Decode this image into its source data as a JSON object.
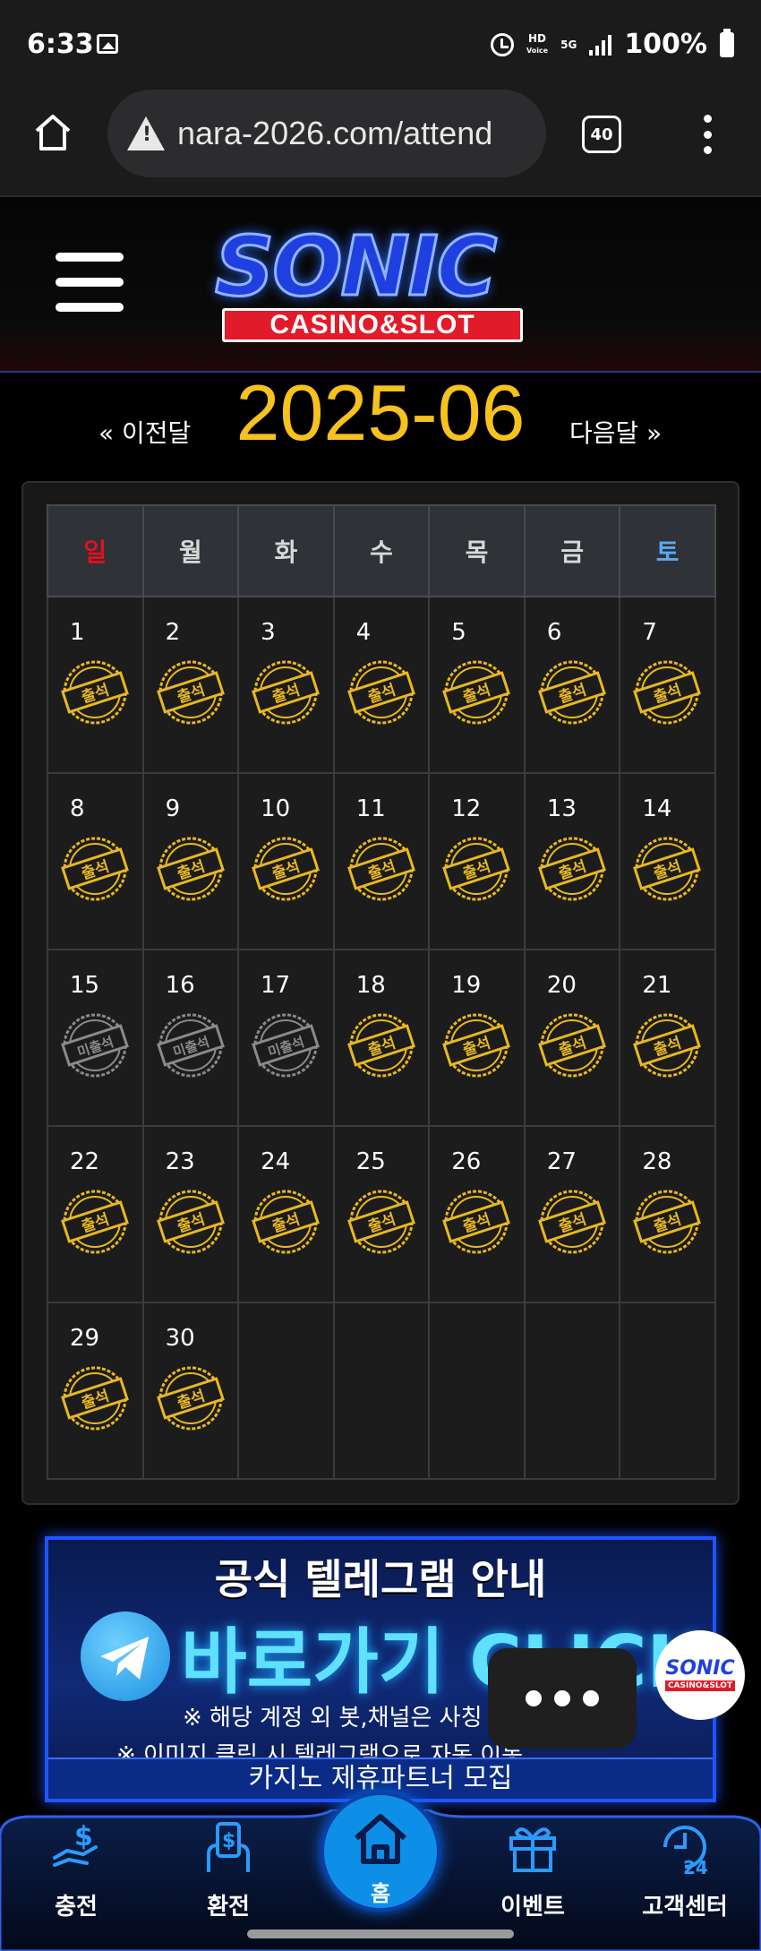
{
  "status_bar": {
    "time": "6:33",
    "network_label": "5G",
    "hd_label": "HD",
    "voice_label": "Voice",
    "battery": "100%"
  },
  "browser": {
    "url": "nara-2026.com/attend",
    "tab_count": "40"
  },
  "site": {
    "logo_word": "SONIC",
    "logo_sub": "CASINO&SLOT"
  },
  "month_nav": {
    "prev_label": "« 이전달",
    "title": "2025-06",
    "next_label": "다음달 »"
  },
  "calendar": {
    "weekdays": [
      "일",
      "월",
      "화",
      "수",
      "목",
      "금",
      "토"
    ],
    "weeks": [
      [
        {
          "day": "1",
          "stamp": "출석"
        },
        {
          "day": "2",
          "stamp": "출석"
        },
        {
          "day": "3",
          "stamp": "출석"
        },
        {
          "day": "4",
          "stamp": "출석"
        },
        {
          "day": "5",
          "stamp": "출석"
        },
        {
          "day": "6",
          "stamp": "출석"
        },
        {
          "day": "7",
          "stamp": "출석"
        }
      ],
      [
        {
          "day": "8",
          "stamp": "출석"
        },
        {
          "day": "9",
          "stamp": "출석"
        },
        {
          "day": "10",
          "stamp": "출석"
        },
        {
          "day": "11",
          "stamp": "출석"
        },
        {
          "day": "12",
          "stamp": "출석"
        },
        {
          "day": "13",
          "stamp": "출석"
        },
        {
          "day": "14",
          "stamp": "출석"
        }
      ],
      [
        {
          "day": "15",
          "stamp": "미출석"
        },
        {
          "day": "16",
          "stamp": "미출석"
        },
        {
          "day": "17",
          "stamp": "미출석"
        },
        {
          "day": "18",
          "stamp": "출석"
        },
        {
          "day": "19",
          "stamp": "출석"
        },
        {
          "day": "20",
          "stamp": "출석"
        },
        {
          "day": "21",
          "stamp": "출석"
        }
      ],
      [
        {
          "day": "22",
          "stamp": "출석"
        },
        {
          "day": "23",
          "stamp": "출석"
        },
        {
          "day": "24",
          "stamp": "출석"
        },
        {
          "day": "25",
          "stamp": "출석"
        },
        {
          "day": "26",
          "stamp": "출석"
        },
        {
          "day": "27",
          "stamp": "출석"
        },
        {
          "day": "28",
          "stamp": "출석"
        }
      ],
      [
        {
          "day": "29",
          "stamp": "출석"
        },
        {
          "day": "30",
          "stamp": "출석"
        },
        {
          "day": "",
          "stamp": ""
        },
        {
          "day": "",
          "stamp": ""
        },
        {
          "day": "",
          "stamp": ""
        },
        {
          "day": "",
          "stamp": ""
        },
        {
          "day": "",
          "stamp": ""
        }
      ]
    ],
    "stamp_colors": {
      "출석": "#e8b820",
      "미출석": "#8a8a8a"
    },
    "sunday_color": "#e0121e",
    "saturday_color": "#5aa8f5"
  },
  "banner": {
    "title": "공식 텔레그램 안내",
    "cta": "바로가기 CLICK",
    "note_1": "※ 해당 계정 외 봇,채널은 사칭",
    "note_2": "※ 이미지 클릭 시 텔레그램으로 자동 이동",
    "footer": "카지노 제휴파트너 모집",
    "icon": "telegram-icon"
  },
  "float_logo": {
    "word": "SONIC",
    "sub": "CASINO&SLOT"
  },
  "bottom_nav": {
    "items": [
      {
        "label": "충전",
        "icon": "deposit-icon"
      },
      {
        "label": "환전",
        "icon": "withdraw-icon"
      },
      {
        "label": "홈",
        "icon": "home-icon"
      },
      {
        "label": "이벤트",
        "icon": "gift-icon"
      },
      {
        "label": "고객센터",
        "icon": "support-24-icon"
      }
    ],
    "accent_color": "#0d8fe8"
  }
}
